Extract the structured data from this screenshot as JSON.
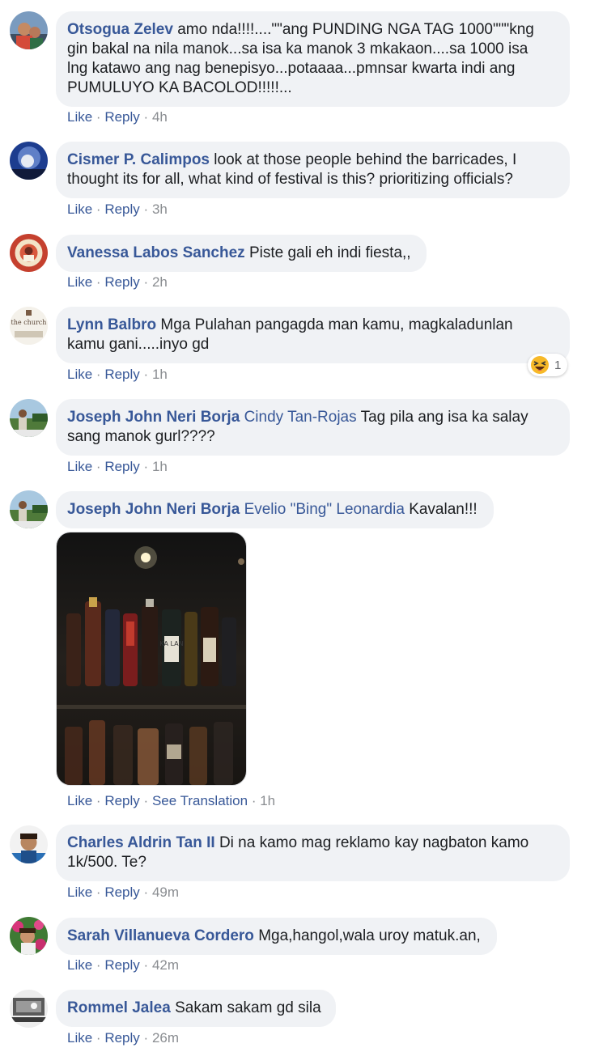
{
  "ui": {
    "like": "Like",
    "reply": "Reply",
    "see_translation": "See Translation",
    "dot": "·"
  },
  "colors": {
    "name": "#385898",
    "bubble": "#f0f2f5",
    "meta": "#8a8d91"
  },
  "comments": [
    {
      "author": "Otsogua Zelev",
      "line1": "amo nda!!!!....\"\"ang PUNDING NGA TAG 1000\"\"\"kng",
      "line2": "gin bakal na nila manok...sa isa ka manok 3 mkakaon....sa 1000 isa",
      "line3": "lng katawo ang nag benepisyo...potaaaa...pmnsar kwarta indi ang",
      "line4": "PUMULUYO KA BACOLOD!!!!!...",
      "time": "4h"
    },
    {
      "author": "Cismer P. Calimpos",
      "line1": "look at those people behind the barricades, I",
      "line2": "thought its for all, what kind of festival is this? prioritizing officials?",
      "time": "3h"
    },
    {
      "author": "Vanessa Labos Sanchez",
      "line1": "Piste gali eh indi fiesta,,",
      "time": "2h"
    },
    {
      "author": "Lynn Balbro",
      "line1": "Mga Pulahan pangagda man kamu, magkaladunlan",
      "line2": "kamu gani.....inyo gd",
      "time": "1h",
      "reaction_icon": "haha-emoji-icon",
      "reaction_count": "1",
      "avatar_text": "the church"
    },
    {
      "author": "Joseph John Neri Borja",
      "tag": "Cindy Tan-Rojas",
      "line1": "Tag pila ang isa ka salay",
      "line2": "sang manok gurl????",
      "time": "1h"
    },
    {
      "author": "Joseph John Neri Borja",
      "tag": "Evelio \"Bing\" Leonardia",
      "line1": "Kavalan!!!",
      "time": "1h",
      "photo_label": "KA LAN"
    },
    {
      "author": "Charles Aldrin Tan II",
      "line1": "Di na kamo mag reklamo kay nagbaton kamo",
      "line2": "1k/500. Te?",
      "time": "49m"
    },
    {
      "author": "Sarah Villanueva Cordero",
      "line1": "Mga,hangol,wala uroy matuk.an,",
      "time": "42m"
    },
    {
      "author": "Rommel Jalea",
      "line1": "Sakam sakam gd sila",
      "time": "26m"
    }
  ]
}
